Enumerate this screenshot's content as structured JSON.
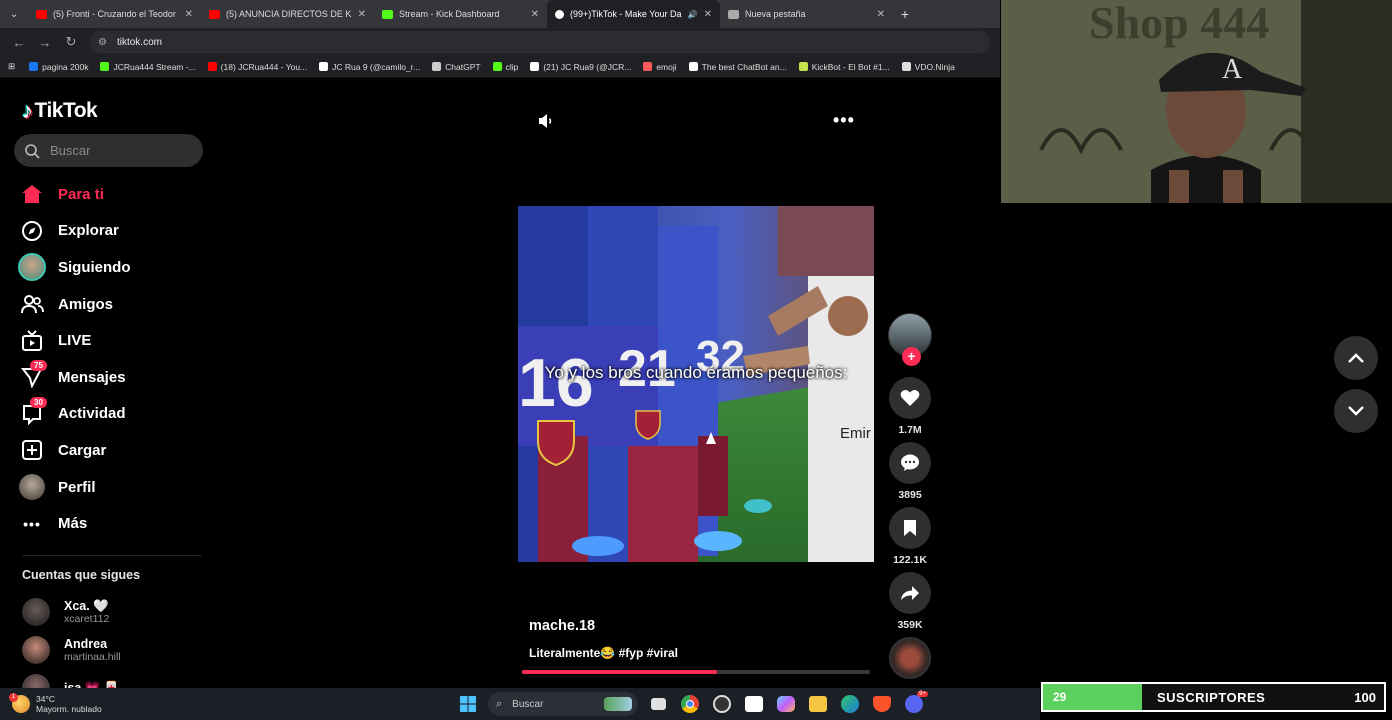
{
  "browser": {
    "tabs": [
      {
        "title": "(5) Fronti - Cruzando el Teodor",
        "color": "#ff0000",
        "active": false
      },
      {
        "title": "(5) ANUNCIA DIRECTOS DE KIC",
        "color": "#ff0000",
        "active": false
      },
      {
        "title": "Stream - Kick Dashboard",
        "color": "#53fc18",
        "active": false
      },
      {
        "title": "(99+)TikTok - Make Your Da",
        "color": "#ffffff",
        "active": true
      },
      {
        "title": "Nueva pestaña",
        "color": "#aaaaaa",
        "active": false
      }
    ],
    "new_tab": "+",
    "address": "tiktok.com",
    "bookmarks": [
      {
        "label": "pagina 200k",
        "color": "#1877f2"
      },
      {
        "label": "JCRua444 Stream -...",
        "color": "#53fc18"
      },
      {
        "label": "(18) JCRua444 - You...",
        "color": "#ff0000"
      },
      {
        "label": "JC Rua 9 (@camilo_r...",
        "color": "#ffffff"
      },
      {
        "label": "ChatGPT",
        "color": "#cccccc"
      },
      {
        "label": "clip",
        "color": "#53fc18"
      },
      {
        "label": "(21) JC Rua9 (@JCR...",
        "color": "#ffffff"
      },
      {
        "label": "emoji",
        "color": "#ff5a5a"
      },
      {
        "label": "The best ChatBot an...",
        "color": "#ffffff"
      },
      {
        "label": "KickBot - El Bot #1...",
        "color": "#c7e34b"
      },
      {
        "label": "VDO.Ninja",
        "color": "#dddddd"
      }
    ]
  },
  "tiktok": {
    "brand": "TikTok",
    "search_placeholder": "Buscar",
    "nav": [
      {
        "label": "Para ti",
        "icon": "home-icon",
        "active": true
      },
      {
        "label": "Explorar",
        "icon": "compass-icon"
      },
      {
        "label": "Siguiendo",
        "icon": "following-avatar-icon"
      },
      {
        "label": "Amigos",
        "icon": "friends-icon"
      },
      {
        "label": "LIVE",
        "icon": "live-tv-icon"
      },
      {
        "label": "Mensajes",
        "icon": "paper-plane-icon",
        "badge": "75"
      },
      {
        "label": "Actividad",
        "icon": "inbox-icon",
        "badge": "30"
      },
      {
        "label": "Cargar",
        "icon": "upload-plus-icon"
      },
      {
        "label": "Perfil",
        "icon": "profile-avatar-icon"
      },
      {
        "label": "Más",
        "icon": "more-dots-icon"
      }
    ],
    "following_title": "Cuentas que sigues",
    "following": [
      {
        "name": "Xca. 🤍",
        "handle": "xcaret112",
        "color": "#6a5a5a"
      },
      {
        "name": "Andrea",
        "handle": "martinaa.hill",
        "color": "#c98a7a"
      },
      {
        "name": "isa 💗 🀄",
        "handle": "",
        "color": "#8a6a6a"
      }
    ]
  },
  "video": {
    "caption_overlay": "Yo y los bros cuando éramos pequeños:",
    "author": "mache.18",
    "description": "Literalmente😂 #fyp #viral",
    "progress": 0.56,
    "likes": "1.7M",
    "comments": "3895",
    "saves": "122.1K",
    "shares": "359K",
    "jersey_numbers": [
      "16",
      "21",
      "32"
    ],
    "sponsor_text": "Emir"
  },
  "stream_overlay": {
    "webcam_sign": "Shop 444",
    "subs_count": "29",
    "subs_label": "SUSCRIPTORES",
    "subs_goal": "100",
    "subs_progress": 0.29
  },
  "taskbar": {
    "temperature": "34°C",
    "weather": "Mayorm. nublado",
    "search": "Buscar",
    "weather_badge": "1",
    "tray_badge": "9+"
  }
}
